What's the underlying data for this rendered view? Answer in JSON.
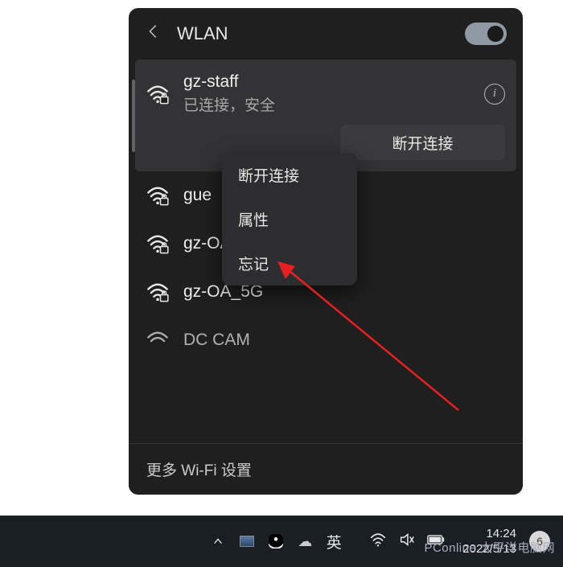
{
  "header": {
    "title": "WLAN"
  },
  "networks": [
    {
      "name": "gz-staff",
      "status": "已连接，安全",
      "connected": true
    },
    {
      "name": "gue",
      "connected": false
    },
    {
      "name": "gz-OA",
      "connected": false
    },
    {
      "name": "gz-OA_5G",
      "connected": false
    },
    {
      "name": "DC  CAM",
      "connected": false,
      "partial": true
    }
  ],
  "disconnect_label": "断开连接",
  "context_menu": {
    "items": [
      "断开连接",
      "属性",
      "忘记"
    ]
  },
  "more_settings": "更多 Wi-Fi 设置",
  "taskbar": {
    "ime": "英",
    "time": "14:24",
    "date": "2022/5/13",
    "notif_count": "6"
  },
  "watermark": "PConline 太平洋电脑网"
}
